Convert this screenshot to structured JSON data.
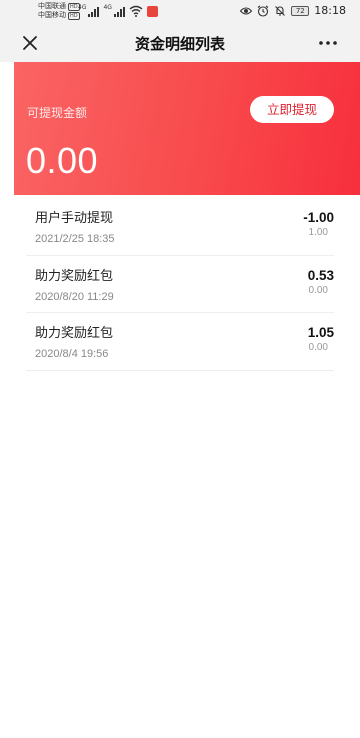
{
  "status_bar": {
    "carrier1": "中国联通",
    "carrier2": "中国移动",
    "hd_badge": "HD",
    "net1": "4G",
    "net2": "4G",
    "battery": "72",
    "time": "18:18"
  },
  "nav": {
    "title": "资金明细列表"
  },
  "balance": {
    "label": "可提现金额",
    "amount": "0.00",
    "withdraw_button": "立即提现"
  },
  "transactions": [
    {
      "title": "用户手动提现",
      "date": "2021/2/25 18:35",
      "amount": "-1.00",
      "sub": "1.00"
    },
    {
      "title": "助力奖励红包",
      "date": "2020/8/20 11:29",
      "amount": "0.53",
      "sub": "0.00"
    },
    {
      "title": "助力奖励红包",
      "date": "2020/8/4 19:56",
      "amount": "1.05",
      "sub": "0.00"
    }
  ],
  "colors": {
    "card_start": "#fa6464",
    "card_end": "#f72f3d",
    "button_text": "#e0202e"
  }
}
